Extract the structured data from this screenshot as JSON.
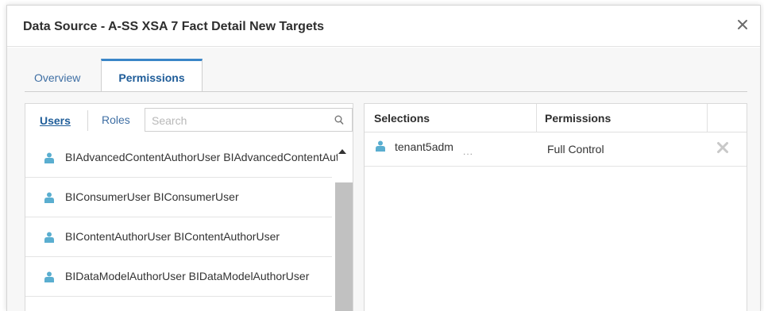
{
  "dialog": {
    "title": "Data Source - A-SS XSA 7 Fact Detail New Targets",
    "close_icon": "close-icon"
  },
  "tabs": [
    {
      "label": "Overview",
      "active": false
    },
    {
      "label": "Permissions",
      "active": true
    }
  ],
  "left_panel": {
    "users_tab": "Users",
    "roles_tab": "Roles",
    "search": {
      "placeholder": "Search",
      "value": "",
      "icon": "search-icon"
    },
    "items": [
      {
        "label": "BIAdvancedContentAuthorUser BIAdvancedContentAuthorUser",
        "icon": "user-icon"
      },
      {
        "label": "BIConsumerUser BIConsumerUser",
        "icon": "user-icon"
      },
      {
        "label": "BIContentAuthorUser BIContentAuthorUser",
        "icon": "user-icon"
      },
      {
        "label": "BIDataModelAuthorUser BIDataModelAuthorUser",
        "icon": "user-icon"
      }
    ]
  },
  "right_panel": {
    "columns": {
      "selections": "Selections",
      "permissions": "Permissions"
    },
    "rows": [
      {
        "user": "tenant5adm",
        "ellipsis": "...",
        "permission": "Full Control",
        "icon": "user-icon",
        "delete_icon": "delete-x-icon"
      }
    ]
  },
  "colors": {
    "accent_blue": "#3a86c8",
    "link_blue": "#1f5d99",
    "user_icon": "#5aaed0",
    "scroll_thumb": "#c1c1c1"
  }
}
